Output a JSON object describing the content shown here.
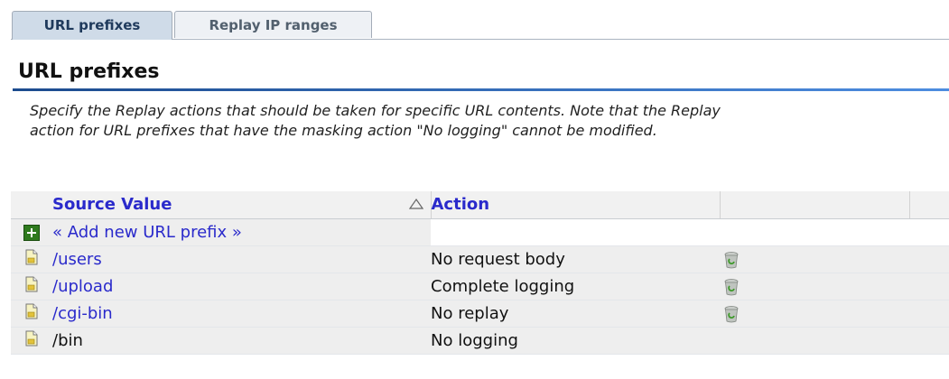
{
  "tabs": [
    {
      "label": "URL prefixes",
      "active": true
    },
    {
      "label": "Replay IP ranges",
      "active": false
    }
  ],
  "page": {
    "title": "URL prefixes",
    "description_line1": "Specify the Replay actions that should be taken for specific URL contents. Note that the Replay",
    "description_line2": "action for URL prefixes that have the masking action \"No logging\" cannot be modified."
  },
  "table": {
    "columns": {
      "source": "Source Value",
      "action": "Action"
    },
    "sort": {
      "column": "source",
      "icon": "sort-triangle-icon"
    },
    "add_link": "« Add new URL prefix »",
    "rows": [
      {
        "source": "/users",
        "action": "No request body",
        "deletable": true,
        "icon": "document-icon"
      },
      {
        "source": "/upload",
        "action": "Complete logging",
        "deletable": true,
        "icon": "document-icon"
      },
      {
        "source": "/cgi-bin",
        "action": "No replay",
        "deletable": true,
        "icon": "document-icon"
      },
      {
        "source": "/bin",
        "action": "No logging",
        "deletable": false,
        "icon": "document-icon"
      }
    ]
  },
  "colors": {
    "link": "#2a2acb",
    "active_tab": "#cfdbe8",
    "rule": "#1c4b8e",
    "add_icon": "#2f7a1e"
  }
}
